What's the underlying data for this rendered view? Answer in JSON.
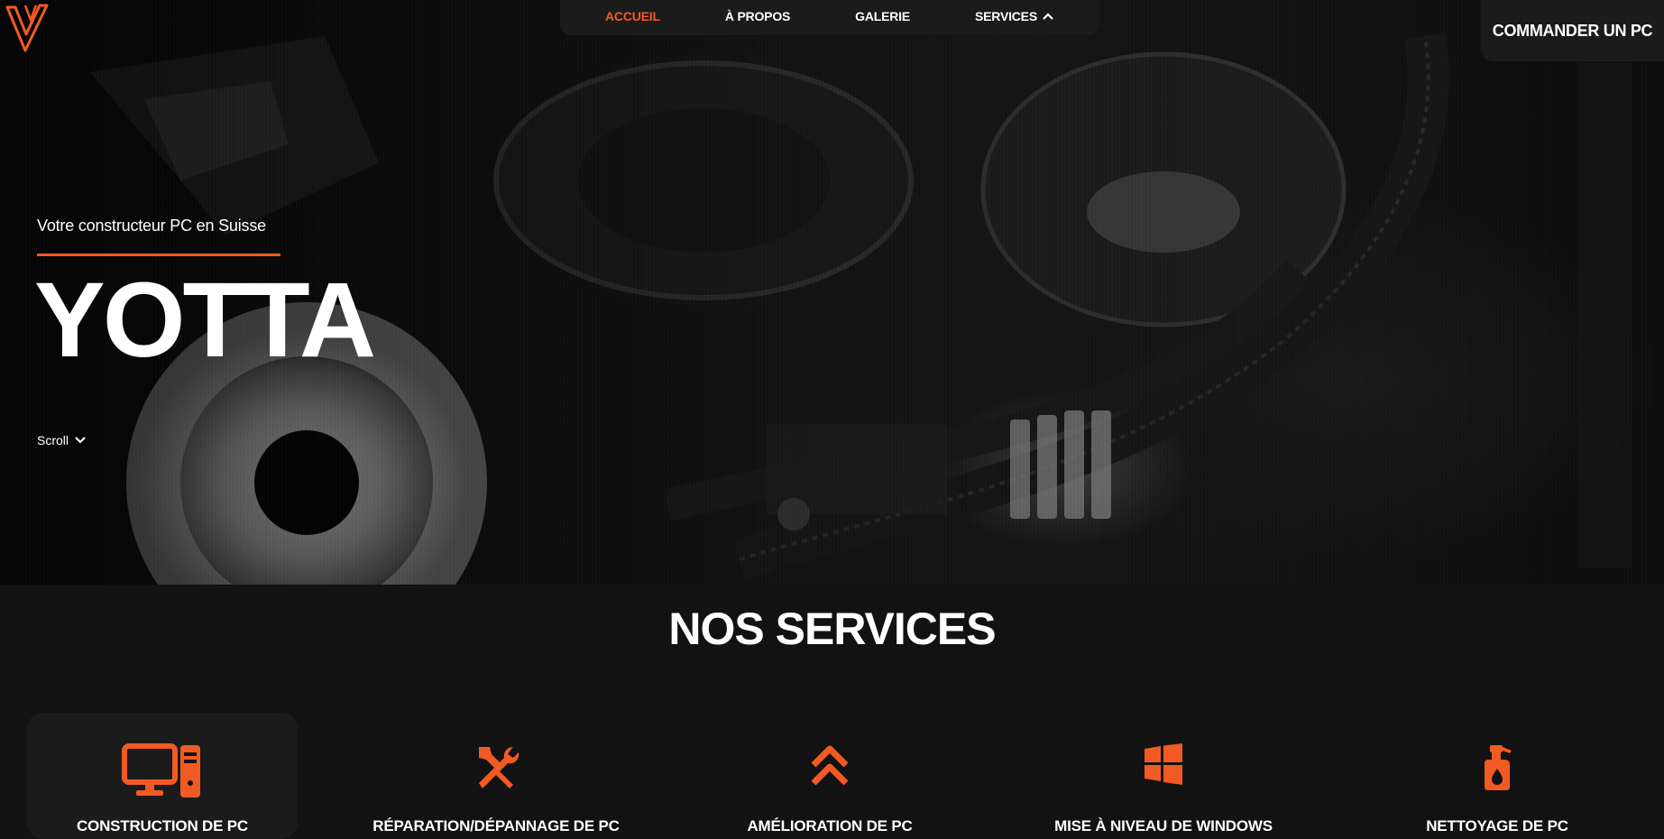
{
  "brand": {
    "logo_alt": "Yotta logo",
    "accent": "#f25a24"
  },
  "nav": {
    "items": [
      {
        "label": "ACCUEIL",
        "active": true
      },
      {
        "label": "À PROPOS",
        "active": false
      },
      {
        "label": "GALERIE",
        "active": false
      },
      {
        "label": "SERVICES",
        "active": false,
        "icon": "chevron-up-icon"
      }
    ]
  },
  "cta": {
    "label": "COMMANDER UN PC"
  },
  "hero": {
    "tagline": "Votre constructeur PC en Suisse",
    "title": "YOTTA",
    "scroll_label": "Scroll"
  },
  "services": {
    "title": "NOS SERVICES",
    "items": [
      {
        "label": "CONSTRUCTION DE PC",
        "icon": "desktop-tower-icon",
        "active": true
      },
      {
        "label": "RÉPARATION/DÉPANNAGE DE PC",
        "icon": "tools-icon",
        "active": false
      },
      {
        "label": "AMÉLIORATION DE PC",
        "icon": "double-chevron-up-icon",
        "active": false
      },
      {
        "label": "MISE À NIVEAU DE WINDOWS",
        "icon": "windows-icon",
        "active": false
      },
      {
        "label": "NETTOYAGE DE PC",
        "icon": "spray-bottle-icon",
        "active": false
      }
    ]
  }
}
